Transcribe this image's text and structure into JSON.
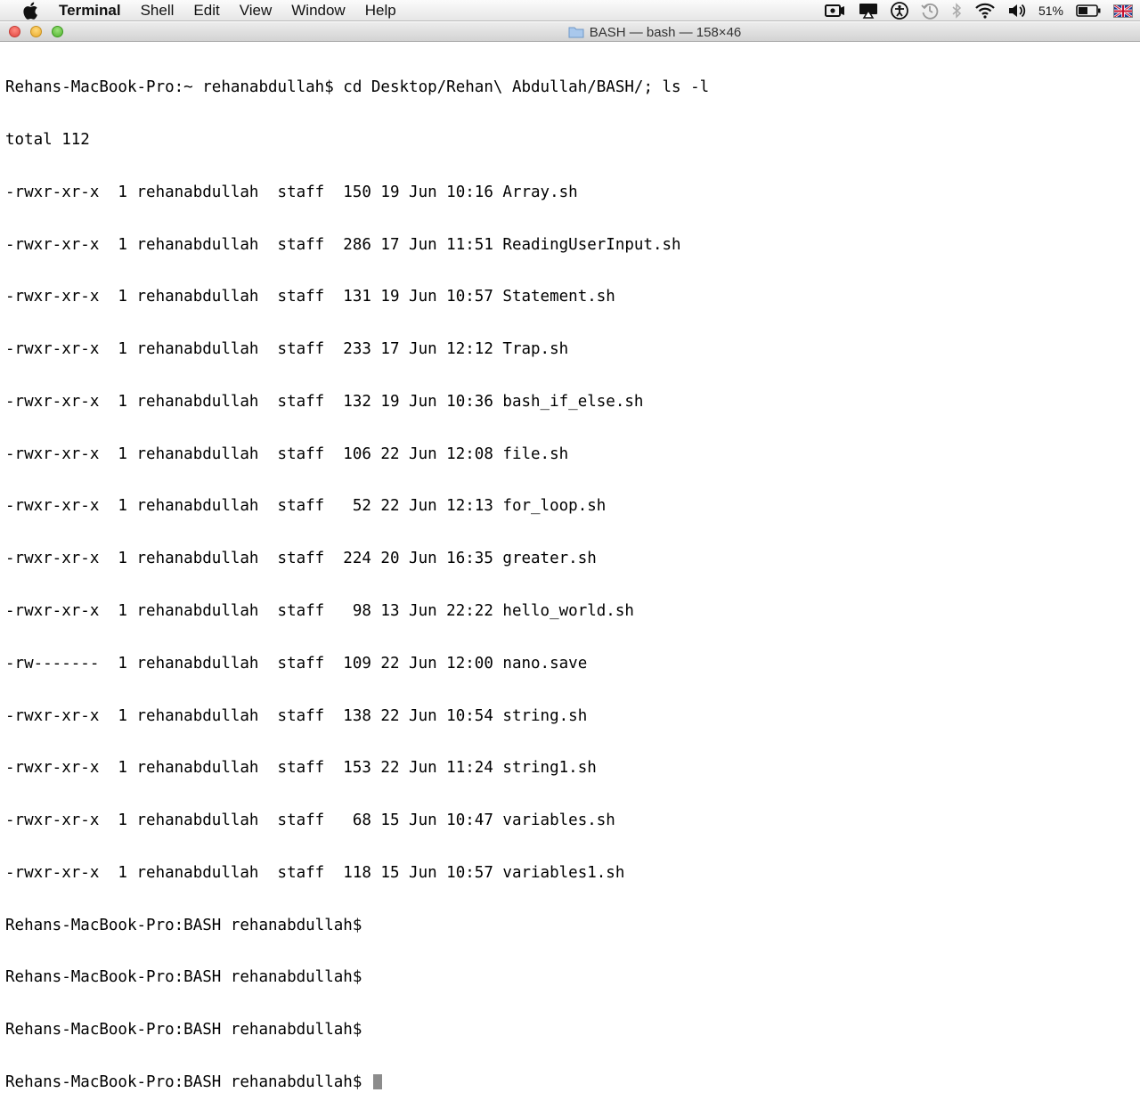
{
  "menubar": {
    "app_name": "Terminal",
    "menus": [
      "Shell",
      "Edit",
      "View",
      "Window",
      "Help"
    ],
    "battery_percent": "51%",
    "icons": [
      "apple-icon",
      "screen-mirroring-icon",
      "airplay-icon",
      "accessibility-icon",
      "time-machine-icon",
      "bluetooth-icon",
      "wifi-icon",
      "volume-icon",
      "battery-icon",
      "uk-flag-icon"
    ]
  },
  "window": {
    "title": "BASH — bash — 158×46",
    "folder_icon": "folder-icon"
  },
  "terminal": {
    "command_line": "Rehans-MacBook-Pro:~ rehanabdullah$ cd Desktop/Rehan\\ Abdullah/BASH/; ls -l",
    "total_line": "total 112",
    "listing": [
      "-rwxr-xr-x  1 rehanabdullah  staff  150 19 Jun 10:16 Array.sh",
      "-rwxr-xr-x  1 rehanabdullah  staff  286 17 Jun 11:51 ReadingUserInput.sh",
      "-rwxr-xr-x  1 rehanabdullah  staff  131 19 Jun 10:57 Statement.sh",
      "-rwxr-xr-x  1 rehanabdullah  staff  233 17 Jun 12:12 Trap.sh",
      "-rwxr-xr-x  1 rehanabdullah  staff  132 19 Jun 10:36 bash_if_else.sh",
      "-rwxr-xr-x  1 rehanabdullah  staff  106 22 Jun 12:08 file.sh",
      "-rwxr-xr-x  1 rehanabdullah  staff   52 22 Jun 12:13 for_loop.sh",
      "-rwxr-xr-x  1 rehanabdullah  staff  224 20 Jun 16:35 greater.sh",
      "-rwxr-xr-x  1 rehanabdullah  staff   98 13 Jun 22:22 hello_world.sh",
      "-rw-------  1 rehanabdullah  staff  109 22 Jun 12:00 nano.save",
      "-rwxr-xr-x  1 rehanabdullah  staff  138 22 Jun 10:54 string.sh",
      "-rwxr-xr-x  1 rehanabdullah  staff  153 22 Jun 11:24 string1.sh",
      "-rwxr-xr-x  1 rehanabdullah  staff   68 15 Jun 10:47 variables.sh",
      "-rwxr-xr-x  1 rehanabdullah  staff  118 15 Jun 10:57 variables1.sh"
    ],
    "prompts": [
      "Rehans-MacBook-Pro:BASH rehanabdullah$",
      "Rehans-MacBook-Pro:BASH rehanabdullah$",
      "Rehans-MacBook-Pro:BASH rehanabdullah$"
    ],
    "active_prompt": "Rehans-MacBook-Pro:BASH rehanabdullah$ "
  }
}
